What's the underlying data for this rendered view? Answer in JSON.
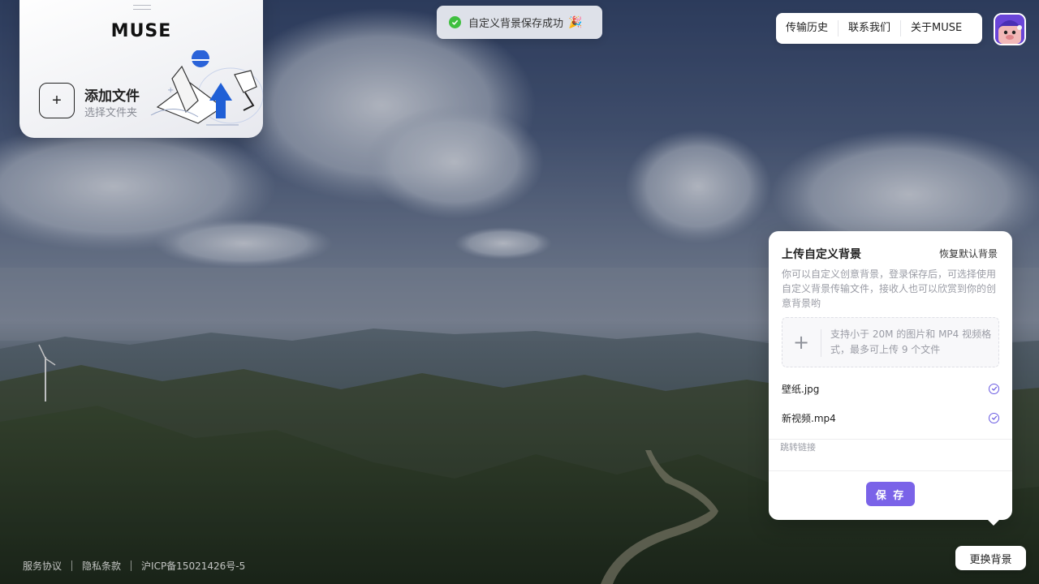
{
  "toast": {
    "message": "自定义背景保存成功",
    "emoji": "🎉",
    "icon": "success-check-icon"
  },
  "brand": {
    "title": "MUSE",
    "add_title": "添加文件",
    "add_subtitle": "选择文件夹",
    "add_icon": "plus-icon"
  },
  "nav": {
    "items": [
      "传输历史",
      "联系我们",
      "关于MUSE"
    ]
  },
  "panel": {
    "title": "上传自定义背景",
    "reset": "恢复默认背景",
    "description": "你可以自定义创意背景，登录保存后，可选择使用自定义背景传输文件，接收人也可以欣赏到你的创意背景哟",
    "dropzone_hint": "支持小于 20M 的图片和 MP4 视频格式，最多可上传 9 个文件",
    "files": [
      {
        "name": "壁纸.jpg",
        "status_icon": "check-circle-icon"
      },
      {
        "name": "新视频.mp4",
        "status_icon": "check-circle-icon"
      }
    ],
    "link_placeholder": "跳转链接",
    "save_label": "保 存"
  },
  "change_bg_label": "更换背景",
  "footer": {
    "links": [
      "服务协议",
      "隐私条款",
      "沪ICP备15021426号-5"
    ]
  },
  "colors": {
    "accent": "#7a63e8",
    "success": "#3fbf3f"
  }
}
